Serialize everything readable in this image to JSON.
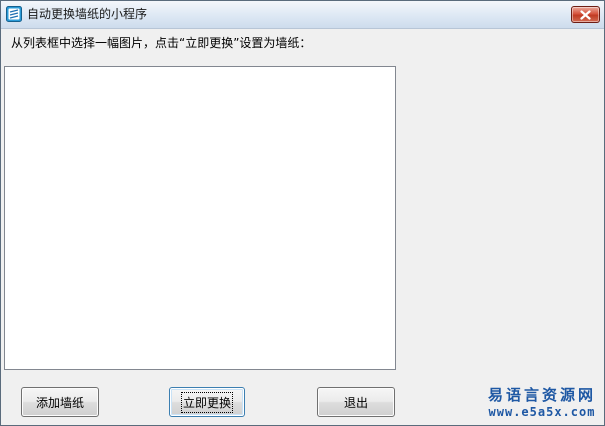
{
  "window": {
    "title": "自动更换墙纸的小程序"
  },
  "main": {
    "instruction": "从列表框中选择一幅图片，点击“立即更换”设置为墙纸：",
    "wallpaper_list": {
      "items": []
    }
  },
  "buttons": {
    "add_label": "添加墙纸",
    "apply_label": "立即更换",
    "exit_label": "退出"
  },
  "watermark": {
    "name": "易语言资源网",
    "url": "www.e5a5x.com"
  },
  "icons": {
    "app": "app-icon",
    "close": "close-icon"
  },
  "colors": {
    "close_button": "#c13b24",
    "watermark": "#1e58a4",
    "focus_border": "#3c7fb1"
  }
}
